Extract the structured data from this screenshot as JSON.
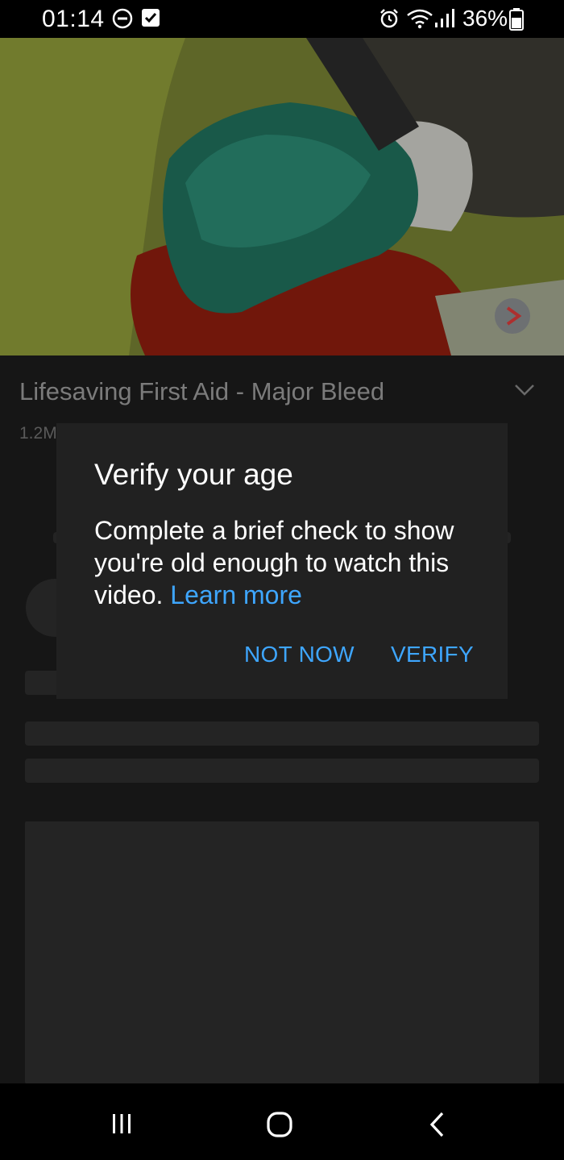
{
  "status_bar": {
    "time": "01:14",
    "battery": "36%",
    "icons": [
      "do-not-disturb-icon",
      "checkbox-notification-icon",
      "alarm-icon",
      "wifi-icon",
      "signal-icon",
      "battery-icon"
    ]
  },
  "video": {
    "title": "Lifesaving First Aid - Major Bleed",
    "views": "1.2M"
  },
  "dialog": {
    "title": "Verify your age",
    "body": "Complete a brief check to show you're old enough to watch this video.",
    "learn_more": "Learn more",
    "not_now": "NOT NOW",
    "verify": "VERIFY"
  },
  "colors": {
    "accent": "#3ea6ff",
    "dialog_bg": "#212121",
    "page_bg": "#0f0f0f"
  },
  "nav_bar": {
    "icons": [
      "recent-apps-icon",
      "home-icon",
      "back-icon"
    ]
  }
}
